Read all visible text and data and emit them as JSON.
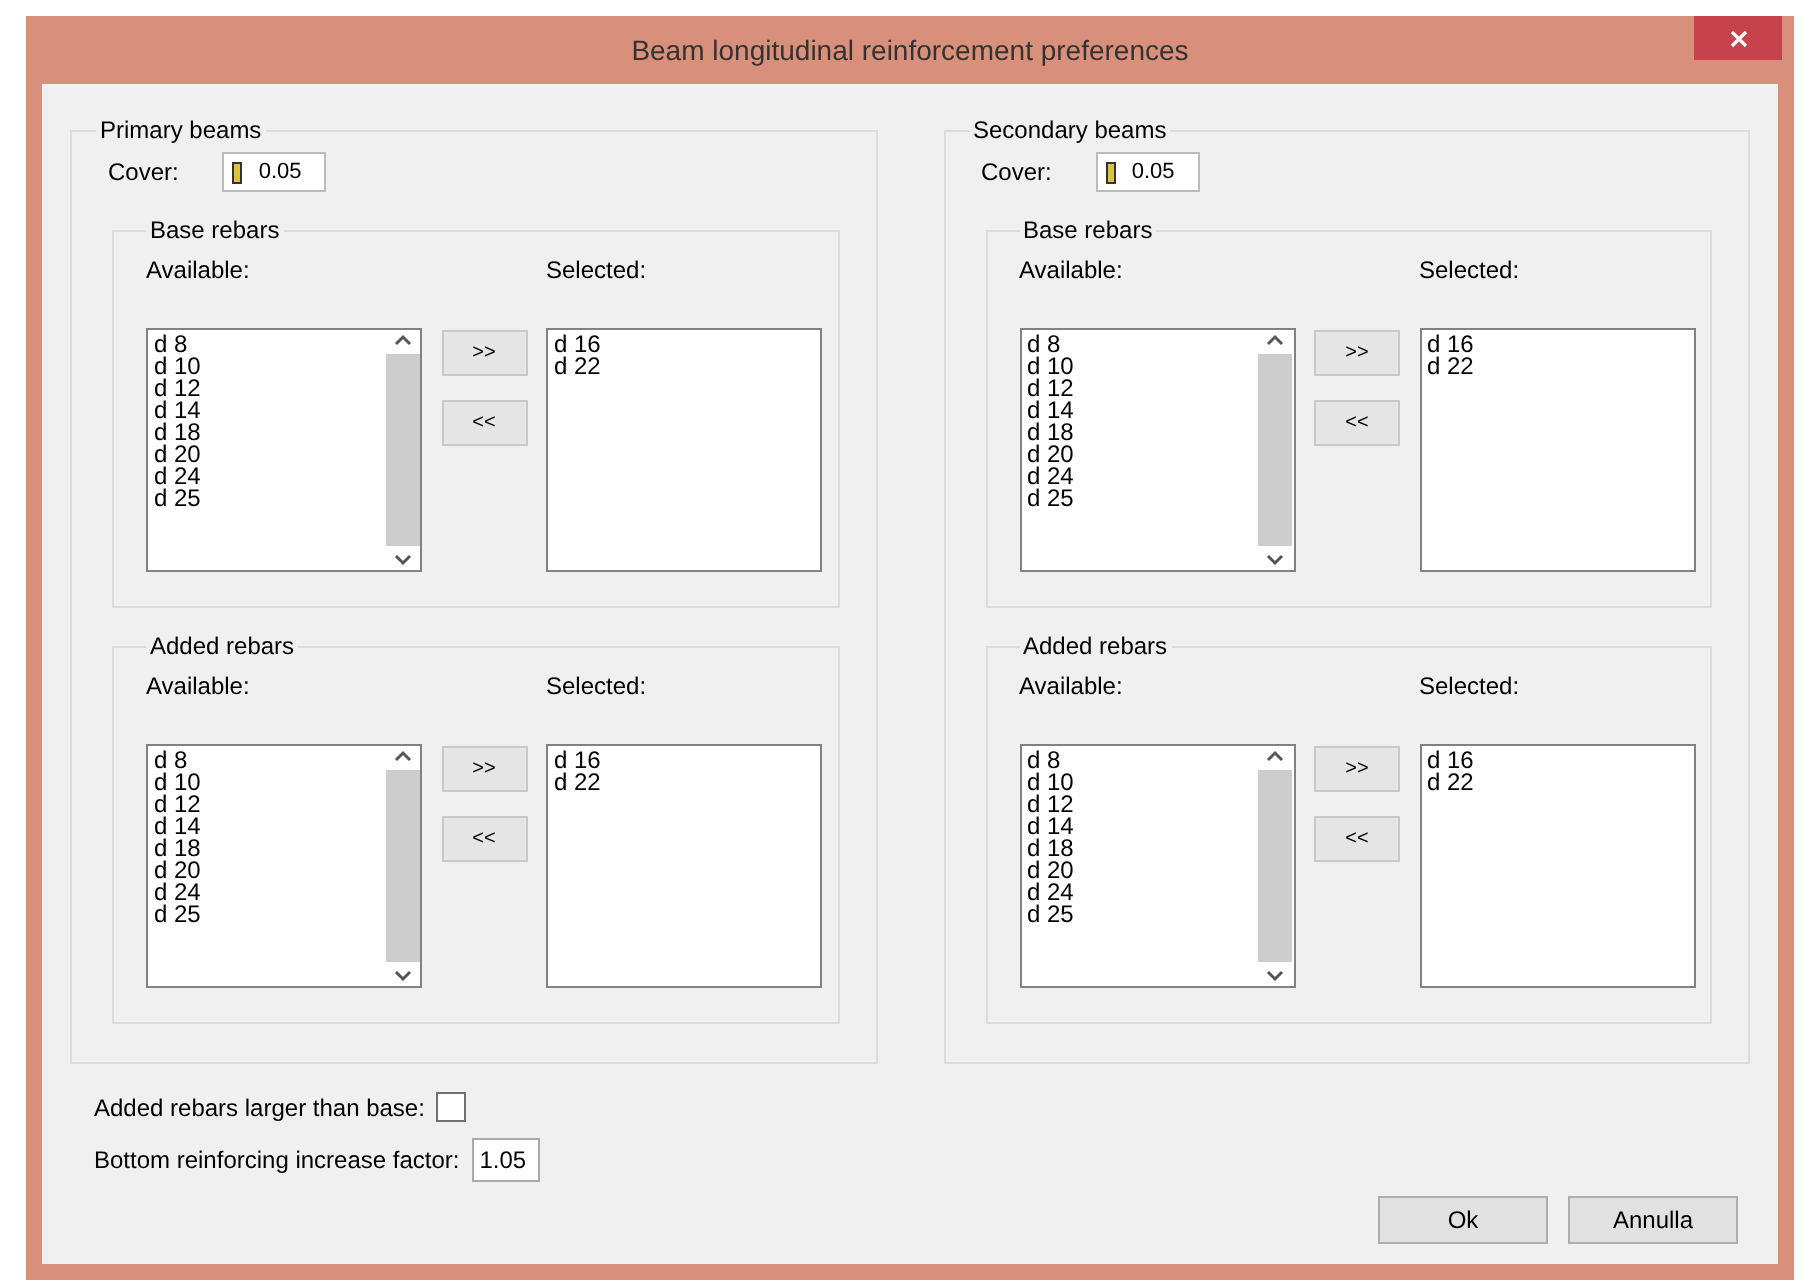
{
  "window": {
    "title": "Beam longitudinal reinforcement preferences"
  },
  "groups": [
    {
      "title": "Primary beams",
      "cover_label": "Cover:",
      "cover_value": "0.05",
      "sections": [
        {
          "title": "Base rebars",
          "available_label": "Available:",
          "selected_label": "Selected:",
          "available": [
            "d 8",
            "d 10",
            "d 12",
            "d 14",
            "d 18",
            "d 20",
            "d 24",
            "d 25"
          ],
          "selected": [
            "d 16",
            "d 22"
          ],
          "add_button": ">>",
          "remove_button": "<<"
        },
        {
          "title": "Added rebars",
          "available_label": "Available:",
          "selected_label": "Selected:",
          "available": [
            "d 8",
            "d 10",
            "d 12",
            "d 14",
            "d 18",
            "d 20",
            "d 24",
            "d 25"
          ],
          "selected": [
            "d 16",
            "d 22"
          ],
          "add_button": ">>",
          "remove_button": "<<"
        }
      ]
    },
    {
      "title": "Secondary beams",
      "cover_label": "Cover:",
      "cover_value": "0.05",
      "sections": [
        {
          "title": "Base rebars",
          "available_label": "Available:",
          "selected_label": "Selected:",
          "available": [
            "d 8",
            "d 10",
            "d 12",
            "d 14",
            "d 18",
            "d 20",
            "d 24",
            "d 25"
          ],
          "selected": [
            "d 16",
            "d 22"
          ],
          "add_button": ">>",
          "remove_button": "<<"
        },
        {
          "title": "Added rebars",
          "available_label": "Available:",
          "selected_label": "Selected:",
          "available": [
            "d 8",
            "d 10",
            "d 12",
            "d 14",
            "d 18",
            "d 20",
            "d 24",
            "d 25"
          ],
          "selected": [
            "d 16",
            "d 22"
          ],
          "add_button": ">>",
          "remove_button": "<<"
        }
      ]
    }
  ],
  "larger_than_base": {
    "label": "Added rebars larger than base:",
    "checked": false
  },
  "increase_factor": {
    "label": "Bottom reinforcing increase factor:",
    "value": "1.05"
  },
  "buttons": [
    "Ok",
    "Annulla"
  ]
}
